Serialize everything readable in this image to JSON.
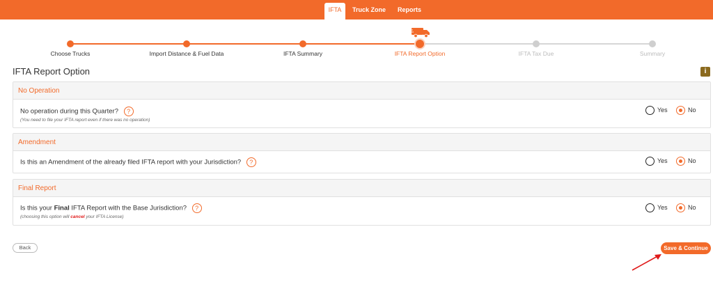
{
  "nav": {
    "tabs": [
      {
        "label": "IFTA"
      },
      {
        "label": "Truck Zone"
      },
      {
        "label": "Reports"
      }
    ]
  },
  "stepper": {
    "steps": [
      {
        "label": "Choose Trucks",
        "state": "done"
      },
      {
        "label": "Import Distance & Fuel Data",
        "state": "done"
      },
      {
        "label": "IFTA Summary",
        "state": "done"
      },
      {
        "label": "IFTA Report Option",
        "state": "current"
      },
      {
        "label": "IFTA Tax Due",
        "state": "todo"
      },
      {
        "label": "Summary",
        "state": "todo"
      }
    ],
    "current_icon": "truck-icon"
  },
  "page": {
    "title": "IFTA Report Option",
    "info_icon": "info-icon"
  },
  "sections": [
    {
      "title": "No Operation",
      "question": "No operation during this Quarter?",
      "note": "(You need to file your IFTA report even if there was no operation)",
      "options": [
        {
          "label": "Yes",
          "checked": false
        },
        {
          "label": "No",
          "checked": true
        }
      ]
    },
    {
      "title": "Amendment",
      "question": "Is this an Amendment of the already filed IFTA report with your Jurisdiction?",
      "options": [
        {
          "label": "Yes",
          "checked": false
        },
        {
          "label": "No",
          "checked": true
        }
      ]
    },
    {
      "title": "Final Report",
      "question_pre": "Is this your ",
      "question_bold": "Final",
      "question_post": " IFTA Report with the Base Jurisdiction?",
      "note_pre": "(choosing this option will ",
      "note_bold": "cancel",
      "note_post": " your IFTA License)",
      "options": [
        {
          "label": "Yes",
          "checked": false
        },
        {
          "label": "No",
          "checked": true
        }
      ]
    }
  ],
  "help_glyph": "?",
  "actions": {
    "back_label": "Back",
    "save_label": "Save & Continue"
  },
  "colors": {
    "accent": "#f26a2a",
    "info": "#8b6a1e",
    "annotation_arrow": "#e01b1b"
  }
}
